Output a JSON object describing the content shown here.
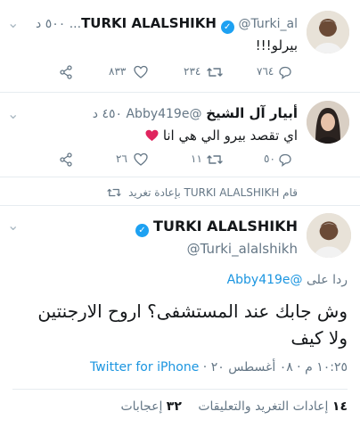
{
  "tweet1": {
    "name": "TURKI ALALSHIKH",
    "handle_time": "@Turki_al... ٥٠٠ د",
    "text": "بيرلو!!!",
    "replies": "٧٦٤",
    "retweets": "٢٣٤",
    "likes": "٨٣٣",
    "avatar_icon": "user-avatar"
  },
  "tweet2": {
    "name": "أبيار آل الشيخ",
    "handle_time": "@Abby419e ٤٥٠ د",
    "text": "اي تقصد بيرو الي هي انا",
    "heart": "❤️",
    "replies": "٥٠",
    "retweets": "١١",
    "likes": "٢٦"
  },
  "retweet_note": "قام TURKI ALALSHIKH بإعادة تغريد",
  "main": {
    "name": "TURKI ALALSHIKH",
    "handle": "@Turki_alalshikh",
    "reply_prefix": "ردا على",
    "reply_to": "@Abby419e",
    "text_line1": "وش جابك عند المستشفى؟ اروح الارجنتين",
    "text_line2": "ولا كيف",
    "timestamp": "١٠:٢٥ م · ٠٨ أغسطس ٢٠ · ",
    "source": "Twitter for iPhone",
    "retweets_count": "١٤",
    "retweets_label": "إعادات التغريد والتعليقات",
    "likes_count": "٣٢",
    "likes_label": "إعجابات"
  },
  "colors": {
    "accent": "#1da1f2",
    "link": "#1b95e0",
    "muted": "#657786",
    "heart": "#e0245e"
  }
}
